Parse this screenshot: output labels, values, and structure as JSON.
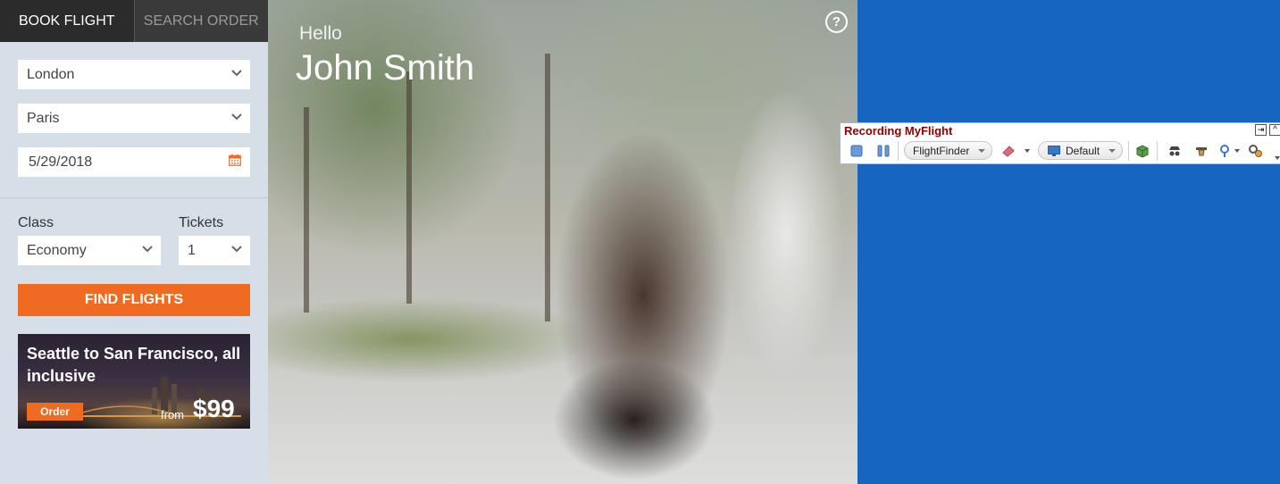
{
  "tabs": [
    {
      "label": "BOOK FLIGHT",
      "active": true
    },
    {
      "label": "SEARCH ORDER",
      "active": false
    }
  ],
  "form": {
    "from": "London",
    "to": "Paris",
    "date": "5/29/2018",
    "class_label": "Class",
    "class_value": "Economy",
    "tickets_label": "Tickets",
    "tickets_value": "1",
    "find_button": "FIND FLIGHTS"
  },
  "promo": {
    "title": "Seattle to San Francisco, all inclusive",
    "order_button": "Order",
    "from_label": "from",
    "price": "$99"
  },
  "greeting": {
    "hello": "Hello",
    "name": "John Smith",
    "help_icon": "?"
  },
  "recorder": {
    "title": "Recording MyFlight",
    "app_selector": "FlightFinder",
    "profile_selector": "Default",
    "pin_icon": "⇥",
    "collapse_icon": "^"
  },
  "colors": {
    "accent": "#ef6b21",
    "desktop": "#1565c0",
    "recorder_title": "#8b0000"
  }
}
